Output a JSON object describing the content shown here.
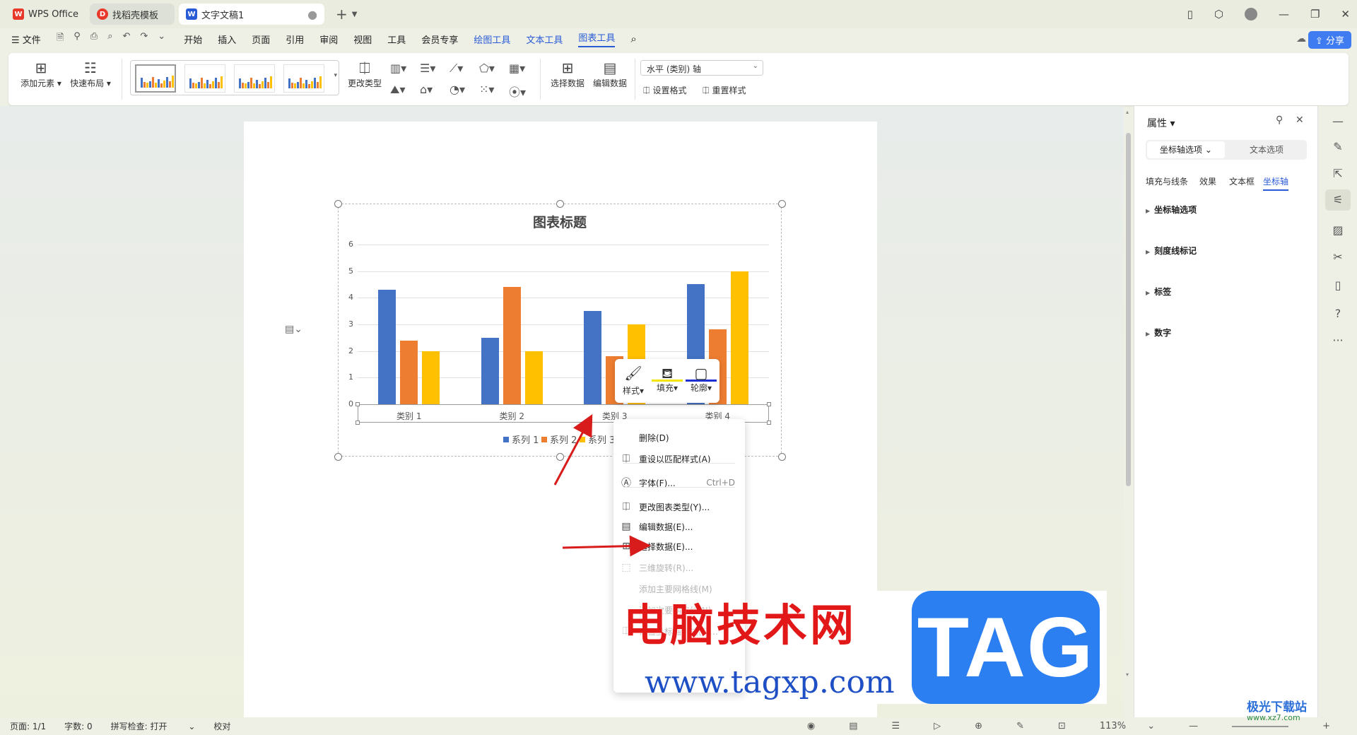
{
  "tabs": [
    {
      "label": "WPS Office",
      "icon": "wps-logo-icon"
    },
    {
      "label": "找稻壳模板",
      "icon": "docer-logo-icon"
    },
    {
      "label": "文字文稿1",
      "icon": "writer-logo-icon"
    }
  ],
  "menu": {
    "file": "文件",
    "items": [
      "开始",
      "插入",
      "页面",
      "引用",
      "审阅",
      "视图",
      "工具",
      "会员专享"
    ],
    "context_tabs": [
      "绘图工具",
      "文本工具",
      "图表工具"
    ],
    "share": "分享"
  },
  "ribbon": {
    "add_element": "添加元素",
    "quick_layout": "快速布局",
    "change_type": "更改类型",
    "select_data": "选择数据",
    "edit_data": "编辑数据",
    "axis_select": "水平 (类别) 轴",
    "set_format": "设置格式",
    "reset_style": "重置样式"
  },
  "chart_data": {
    "type": "bar",
    "title": "图表标题",
    "categories": [
      "类别 1",
      "类别 2",
      "类别 3",
      "类别 4"
    ],
    "series": [
      {
        "name": "系列 1",
        "values": [
          4.3,
          2.5,
          3.5,
          4.5
        ],
        "color": "#4472c4"
      },
      {
        "name": "系列 2",
        "values": [
          2.4,
          4.4,
          1.8,
          2.8
        ],
        "color": "#ed7d31"
      },
      {
        "name": "系列 3",
        "values": [
          2.0,
          2.0,
          3.0,
          5.0
        ],
        "color": "#ffc000"
      }
    ],
    "ylim": [
      0,
      6
    ],
    "yticks": [
      "0",
      "1",
      "2",
      "3",
      "4",
      "5",
      "6"
    ],
    "grid": true,
    "legend": "bottom"
  },
  "floatbar": {
    "style": "样式",
    "fill": "填充",
    "outline": "轮廓"
  },
  "context_menu": [
    {
      "label": "删除(D)",
      "shortcut": "",
      "icon": "",
      "disabled": false
    },
    {
      "label": "重设以匹配样式(A)",
      "shortcut": "",
      "icon": "reset-style-icon",
      "disabled": false
    },
    {
      "label": "字体(F)...",
      "shortcut": "Ctrl+D",
      "icon": "font-icon",
      "disabled": false
    },
    {
      "label": "更改图表类型(Y)...",
      "shortcut": "",
      "icon": "chart-type-icon",
      "disabled": false
    },
    {
      "label": "编辑数据(E)...",
      "shortcut": "",
      "icon": "edit-data-icon",
      "disabled": false
    },
    {
      "label": "选择数据(E)...",
      "shortcut": "",
      "icon": "select-data-icon",
      "disabled": false
    },
    {
      "label": "三维旋转(R)...",
      "shortcut": "",
      "icon": "rotate-3d-icon",
      "disabled": true
    },
    {
      "label": "添加主要网格线(M)",
      "shortcut": "",
      "icon": "",
      "disabled": true
    },
    {
      "label": "添加次要网格线(N)",
      "shortcut": "",
      "icon": "",
      "disabled": true
    },
    {
      "label": "设置坐标轴格式(F)...",
      "shortcut": "",
      "icon": "format-axis-icon",
      "disabled": true
    }
  ],
  "panel": {
    "title": "属性",
    "seg_on": "坐标轴选项",
    "seg_off": "文本选项",
    "subtabs": [
      "填充与线条",
      "效果",
      "文本框",
      "坐标轴"
    ],
    "sections": [
      "坐标轴选项",
      "刻度线标记",
      "标签",
      "数字"
    ]
  },
  "status": {
    "page": "页面: 1/1",
    "words": "字数: 0",
    "spell": "拼写检查: 打开",
    "proof": "校对",
    "zoom": "113%"
  },
  "watermark": {
    "cn": "电脑技术网",
    "url": "www.tagxp.com",
    "tag": "TAG",
    "corner": "极光下载站",
    "corner_url": "www.xz7.com"
  }
}
